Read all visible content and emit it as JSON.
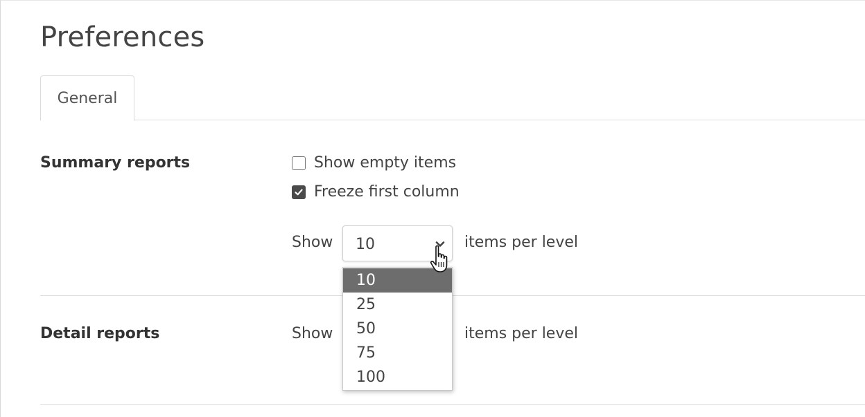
{
  "page": {
    "title": "Preferences"
  },
  "tabs": [
    {
      "label": "General",
      "active": true
    }
  ],
  "summary_reports": {
    "label": "Summary reports",
    "show_empty_items": {
      "label": "Show empty items",
      "checked": false
    },
    "freeze_first_column": {
      "label": "Freeze first column",
      "checked": true
    },
    "show_label": "Show",
    "items_per_level": {
      "value": "10",
      "suffix": "items per level",
      "options": [
        "10",
        "25",
        "50",
        "75",
        "100"
      ],
      "highlighted_option": "10",
      "open": true
    }
  },
  "detail_reports": {
    "label": "Detail reports",
    "show_label": "Show",
    "suffix": "items per level"
  },
  "colors": {
    "selected_option_bg": "#6d6d6d",
    "checkbox_checked": "#4a4a4a"
  },
  "icons": {
    "dropdown_arrow": "chevron-down-icon",
    "checkbox_check": "check-icon",
    "mouse_pointer": "hand-pointer-icon"
  }
}
